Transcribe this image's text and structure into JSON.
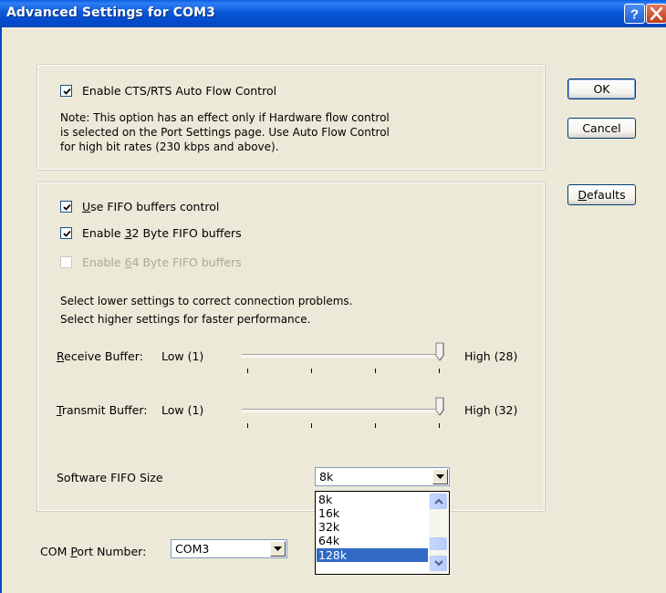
{
  "window": {
    "title": "Advanced Settings for COM3"
  },
  "flow_control": {
    "checkbox_label": "Enable CTS/RTS Auto Flow Control",
    "checked": true,
    "note_lines": [
      "Note: This option has an effect only if Hardware flow control",
      "is selected on the Port Settings page. Use Auto Flow Control",
      "for high bit rates (230 kbps and above)."
    ]
  },
  "fifo": {
    "use_fifo": {
      "pre": "",
      "key": "U",
      "post": "se FIFO buffers control",
      "checked": true
    },
    "enable_32": {
      "pre": "Enable ",
      "key": "3",
      "post": "2 Byte FIFO buffers",
      "checked": true
    },
    "enable_64": {
      "pre": "Enable ",
      "key": "6",
      "post": "4 Byte FIFO buffers",
      "checked": false,
      "disabled": true
    },
    "hint_lines": [
      "Select lower settings to correct connection problems.",
      "Select higher settings for faster performance."
    ],
    "receive": {
      "key": "R",
      "label": "eceive Buffer:",
      "low": "Low (1)",
      "high": "High (28)",
      "value_fraction": 1.0
    },
    "transmit": {
      "key": "T",
      "label": "ransmit Buffer:",
      "low": "Low (1)",
      "high": "High (32)",
      "value_fraction": 1.0
    },
    "software_fifo": {
      "label": "Software FIFO Size",
      "selected": "8k",
      "options": [
        "8k",
        "16k",
        "32k",
        "64k",
        "128k"
      ],
      "highlighted": "128k"
    }
  },
  "com_port": {
    "pre": "COM ",
    "key": "P",
    "post": "ort Number:",
    "selected": "COM3"
  },
  "buttons": {
    "ok": "OK",
    "cancel": "Cancel",
    "defaults_key": "D",
    "defaults_rest": "efaults"
  },
  "colors": {
    "titlebar": "#0a58d8",
    "dialog_bg": "#ece9d8",
    "selection": "#316ac5"
  }
}
